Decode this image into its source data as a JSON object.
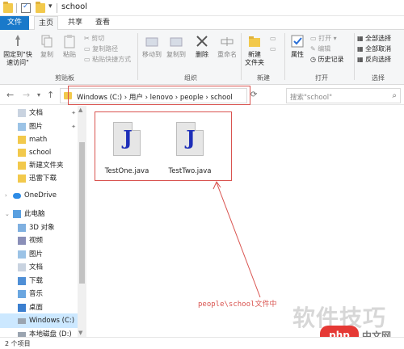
{
  "window": {
    "title": "school"
  },
  "ribbon_tabs": [
    "文件",
    "主页",
    "共享",
    "查看"
  ],
  "ribbon": {
    "clipboard": {
      "pin_label": "固定到\"快\n速访问\"",
      "copy_label": "复制",
      "paste_label": "粘贴",
      "cut_label": "剪切",
      "copy_path_label": "复制路径",
      "paste_shortcut_label": "粘贴快捷方式",
      "group_label": "剪贴板"
    },
    "organize": {
      "move_to_label": "移动到",
      "copy_to_label": "复制到",
      "delete_label": "删除",
      "rename_label": "重命名",
      "group_label": "组织"
    },
    "new": {
      "new_folder_label": "新建\n文件夹",
      "group_label": "新建"
    },
    "open": {
      "properties_label": "属性",
      "open_label": "打开",
      "edit_label": "编辑",
      "history_label": "历史记录",
      "group_label": "打开"
    },
    "select": {
      "select_all_label": "全部选择",
      "select_none_label": "全部取消",
      "invert_label": "反向选择",
      "group_label": "选择"
    }
  },
  "address_bar": {
    "path": "Windows (C:)  ›  用户  ›  lenovo  ›  people  ›  school",
    "search_placeholder": "搜索\"school\""
  },
  "sidebar": {
    "items": [
      {
        "label": "文档",
        "icon": "documents-icon",
        "pinned": true
      },
      {
        "label": "图片",
        "icon": "pictures-icon",
        "pinned": true
      },
      {
        "label": "math",
        "icon": "folder-icon"
      },
      {
        "label": "school",
        "icon": "folder-icon"
      },
      {
        "label": "新建文件夹",
        "icon": "folder-icon"
      },
      {
        "label": "迅雷下载",
        "icon": "folder-icon"
      },
      {
        "label": "OneDrive",
        "icon": "onedrive-icon"
      },
      {
        "label": "此电脑",
        "icon": "pc-icon"
      },
      {
        "label": "3D 对象",
        "icon": "3d-objects-icon"
      },
      {
        "label": "视频",
        "icon": "videos-icon"
      },
      {
        "label": "图片",
        "icon": "pictures-icon"
      },
      {
        "label": "文档",
        "icon": "documents-icon"
      },
      {
        "label": "下载",
        "icon": "downloads-icon"
      },
      {
        "label": "音乐",
        "icon": "music-icon"
      },
      {
        "label": "桌面",
        "icon": "desktop-icon"
      },
      {
        "label": "Windows (C:)",
        "icon": "drive-icon",
        "selected": true
      },
      {
        "label": "本地磁盘 (D:)",
        "icon": "drive-icon"
      }
    ]
  },
  "files": [
    {
      "name": "TestOne.java",
      "icon": "java-file-icon"
    },
    {
      "name": "TestTwo.java",
      "icon": "java-file-icon"
    }
  ],
  "annotation": "people\\school文件中",
  "status": {
    "count": "2 个项目"
  },
  "watermark": {
    "text": "软件技巧",
    "logo": "php",
    "site": "中文网"
  },
  "colors": {
    "accent": "#1979ca",
    "highlight": "#cce8ff",
    "annotation": "#d9534f"
  }
}
